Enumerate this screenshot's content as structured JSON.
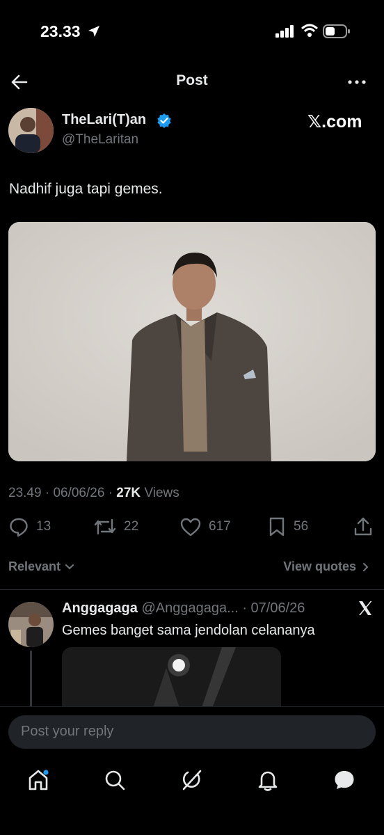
{
  "status": {
    "time": "23.33"
  },
  "header": {
    "title": "Post"
  },
  "author": {
    "name": "TheLari(T)an",
    "handle": "@TheLaritan",
    "source": "𝕏.com"
  },
  "post": {
    "text": "Nadhif juga tapi gemes.",
    "time": "23.49",
    "date": "06/06/26",
    "views_count": "27K",
    "views_label": "Views",
    "separator": "·"
  },
  "actions": {
    "replies": "13",
    "reposts": "22",
    "likes": "617",
    "bookmarks": "56"
  },
  "filter": {
    "sort_label": "Relevant",
    "quotes_label": "View quotes"
  },
  "reply": {
    "name": "Anggagaga",
    "handle": "@Anggagaga...",
    "date": "· 07/06/26",
    "text": "Gemes banget sama jendolan celananya"
  },
  "compose": {
    "placeholder": "Post your reply"
  },
  "colors": {
    "background": "#000000",
    "text": "#e7e9ea",
    "muted": "#71767b",
    "verified": "#1d9bf0"
  },
  "icons": [
    "location-arrow-icon",
    "signal-icon",
    "wifi-icon",
    "battery-icon",
    "back-arrow-icon",
    "more-icon",
    "verified-icon",
    "reply-icon",
    "repost-icon",
    "like-icon",
    "bookmark-icon",
    "share-icon",
    "chevron-down-icon",
    "chevron-right-icon",
    "x-logo-icon",
    "home-icon",
    "search-icon",
    "grok-icon",
    "notifications-icon",
    "messages-icon"
  ]
}
